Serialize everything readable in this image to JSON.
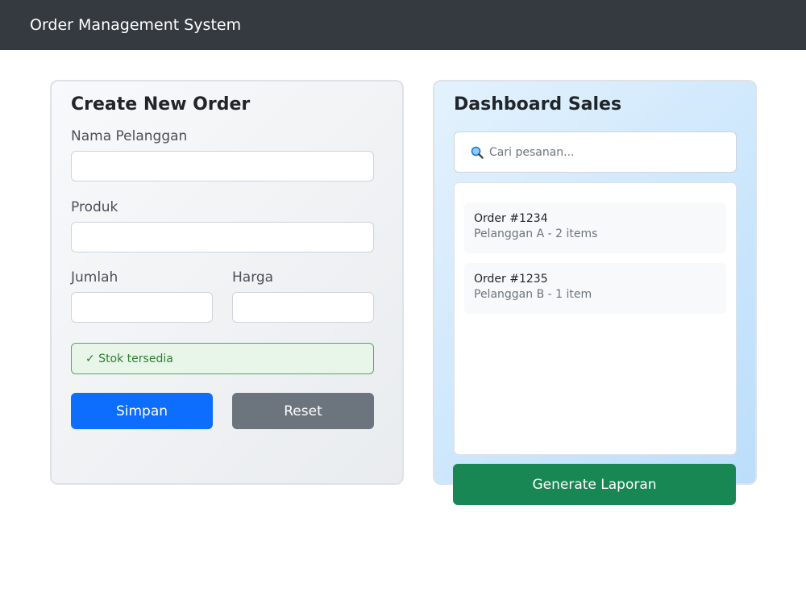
{
  "header": {
    "title": "Order Management System"
  },
  "create_order": {
    "title": "Create New Order",
    "customer_label": "Nama Pelanggan",
    "product_label": "Produk",
    "qty_label": "Jumlah",
    "price_label": "Harga",
    "stock_status": "✓ Stok tersedia",
    "save_label": "Simpan",
    "reset_label": "Reset"
  },
  "dashboard": {
    "title": "Dashboard Sales",
    "search_placeholder": "Cari pesanan...",
    "orders": [
      {
        "title": "Order #1234",
        "detail": "Pelanggan A - 2 items"
      },
      {
        "title": "Order #1235",
        "detail": "Pelanggan B - 1 item"
      }
    ],
    "report_label": "Generate Laporan"
  },
  "colors": {
    "navbar": "#343a40",
    "primary": "#0d6efd",
    "secondary": "#6c757d",
    "success": "#198754",
    "stock_ok": "#2e7d32"
  },
  "icons": {
    "search": "search-icon"
  }
}
